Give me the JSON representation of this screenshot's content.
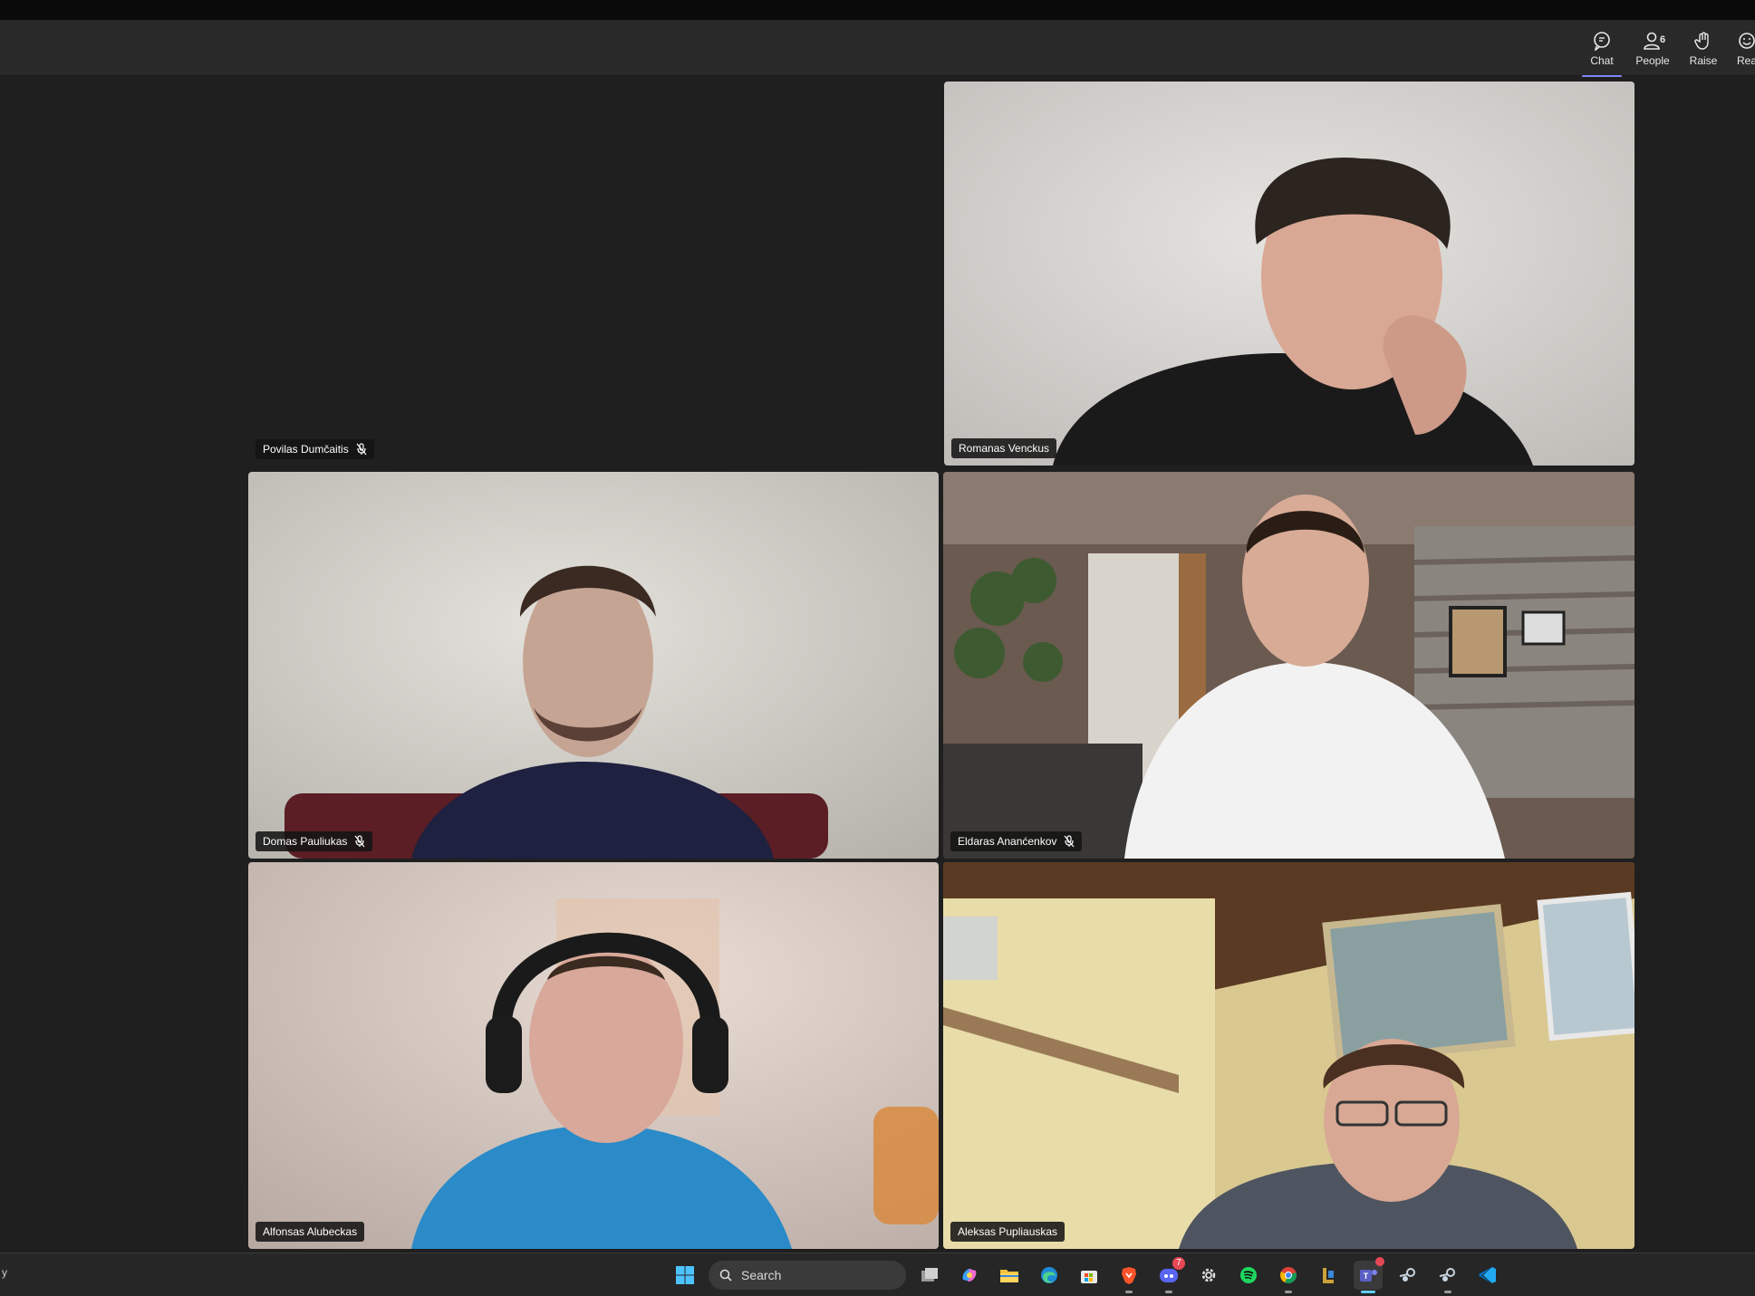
{
  "toolbar": {
    "chat_label": "Chat",
    "people_label": "People",
    "people_count": "6",
    "raise_label": "Raise",
    "react_label": "Rea"
  },
  "participants": [
    {
      "name": "Povilas Dumčaitis",
      "muted": true,
      "camera": false
    },
    {
      "name": "Romanas Venckus",
      "muted": false,
      "camera": true,
      "speaking": true
    },
    {
      "name": "Domas Pauliukas",
      "muted": true,
      "camera": true
    },
    {
      "name": "Eldaras Ananćenkov",
      "muted": true,
      "camera": true
    },
    {
      "name": "Alfonsas Alubeckas",
      "muted": false,
      "camera": true
    },
    {
      "name": "Aleksas Pupliauskas",
      "muted": false,
      "camera": true
    }
  ],
  "taskbar": {
    "left_text": "y",
    "search_placeholder": "Search",
    "discord_badge": "7",
    "apps": [
      "windows-start",
      "task-view",
      "copilot",
      "file-explorer",
      "edge",
      "microsoft-store",
      "brave",
      "discord",
      "settings",
      "spotify",
      "chrome",
      "app",
      "teams",
      "steam",
      "steam",
      "vscode"
    ]
  },
  "colors": {
    "accent": "#7f85f5",
    "active_border": "#8b8ff0",
    "stage_bg": "#1f1f1f",
    "toolbar_bg": "#292929"
  }
}
